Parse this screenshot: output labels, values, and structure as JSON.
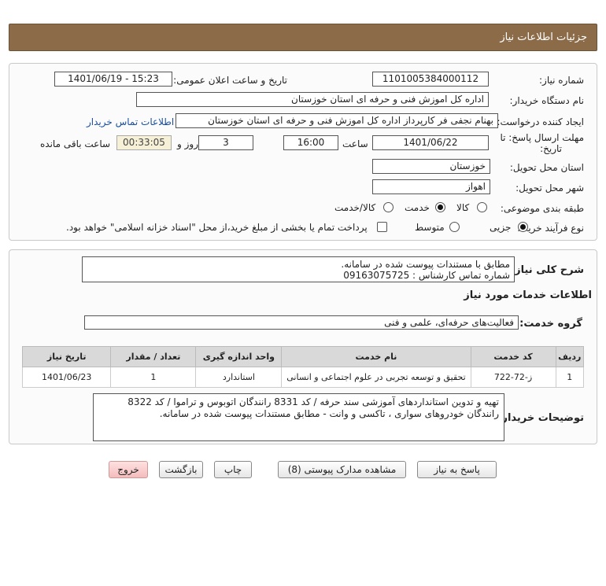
{
  "header": {
    "title": "جزئیات اطلاعات نیاز"
  },
  "info": {
    "need_number_label": "شماره نیاز:",
    "need_number": "1101005384000112",
    "announce_label": "تاریخ و ساعت اعلان عمومی:",
    "announce_value": "1401/06/19 - 15:23",
    "buyer_org_label": "نام دستگاه خریدار:",
    "buyer_org": "اداره کل اموزش فنی و حرفه ای استان خوزستان",
    "creator_label": "ایجاد کننده درخواست:",
    "creator": "بهنام  نجفی فر  کارپرداز اداره کل اموزش فنی و حرفه ای استان خوزستان",
    "contact_link": "اطلاعات تماس خریدار",
    "deadline_label": "مهلت ارسال پاسخ: تا",
    "deadline_label2": "تاریخ:",
    "deadline_date": "1401/06/22",
    "time_label": "ساعت",
    "deadline_time": "16:00",
    "days_value": "3",
    "days_label": "روز و",
    "remaining_time": "00:33:05",
    "remaining_label": "ساعت باقی مانده",
    "province_label": "استان محل تحویل:",
    "province": "خوزستان",
    "city_label": "شهر محل تحویل:",
    "city": "اهواز",
    "category_label": "طبقه بندی موضوعی:",
    "category_options": [
      "کالا",
      "خدمت",
      "کالا/خدمت"
    ],
    "category_selected": "خدمت",
    "process_label": "نوع فرآیند خرید :",
    "process_options": [
      "جزیی",
      "متوسط"
    ],
    "process_selected": "جزیی",
    "payment_note": "پرداخت تمام یا بخشی از مبلغ خرید،از محل \"اسناد خزانه اسلامی\" خواهد بود."
  },
  "summary": {
    "label": "شرح کلی نیاز:",
    "line1": "مطابق با مستندات پیوست شده در سامانه.",
    "line2": "شماره تماس کارشناس : 09163075725"
  },
  "services": {
    "section_title": "اطلاعات خدمات مورد نیاز",
    "group_label": "گروه خدمت:",
    "group_value": "فعالیت‌های حرفه‌ای، علمی و فنی",
    "columns": [
      "ردیف",
      "کد خدمت",
      "نام خدمت",
      "واحد اندازه گیری",
      "تعداد / مقدار",
      "تاریخ نیاز"
    ],
    "rows": [
      {
        "row": "1",
        "code": "ز-72-722",
        "name": "تحقیق و توسعه تجربی در علوم اجتماعی و انسانی",
        "unit": "استاندارد",
        "qty": "1",
        "date": "1401/06/23"
      }
    ]
  },
  "buyer_notes": {
    "label": "توضیحات خریدار:",
    "text": "تهیه و تدوین استانداردهای آموزشی سند حرفه / کد 8331 رانندگان اتوبوس و تراموا / کد 8322 رانندگان خودروهای سواری ، تاکسی و وانت - مطابق مستندات پیوست شده در سامانه."
  },
  "buttons": {
    "reply": "پاسخ به نیاز",
    "attachments": "مشاهده مدارک پیوستی (8)",
    "print": "چاپ",
    "back": "بازگشت",
    "exit": "خروج"
  },
  "colors": {
    "header_bg": "#8c6b49",
    "link": "#1a4fa0",
    "exit_bg": "#f4bcbc",
    "timer_bg": "#f5f0d6"
  }
}
